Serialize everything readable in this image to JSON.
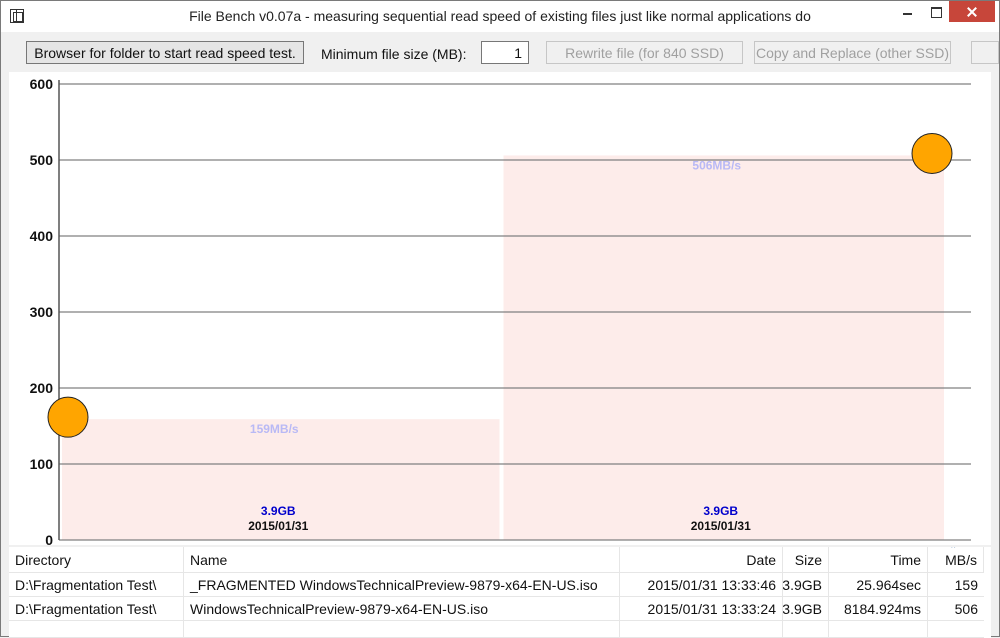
{
  "window": {
    "title": "File Bench v0.07a - measuring sequential read speed of existing files just like normal applications do"
  },
  "toolbar": {
    "browse_label": "Browser for folder to start read speed test.",
    "min_size_label": "Minimum file size (MB):",
    "min_size_value": "1",
    "rewrite_label": "Rewrite file (for 840 SSD)",
    "copy_replace_label": "Copy and Replace (other SSD)"
  },
  "chart_data": {
    "type": "bar",
    "categories": [
      "2015/01/31",
      "2015/01/31"
    ],
    "values": [
      159,
      506
    ],
    "size_labels": [
      "3.9GB",
      "3.9GB"
    ],
    "value_labels": [
      "159MB/s",
      "506MB/s"
    ],
    "title": "",
    "xlabel": "",
    "ylabel": "",
    "ylim": [
      0,
      600
    ],
    "yticks": [
      "0",
      "100",
      "200",
      "300",
      "400",
      "500",
      "600"
    ],
    "grid": true,
    "colors": {
      "bar": "#fdecea",
      "marker": "#ffa500",
      "value_label": "#b9b9f5",
      "size_label": "#0000cc",
      "grid": "#808080"
    }
  },
  "table": {
    "columns": [
      "Directory",
      "Name",
      "Date",
      "Size",
      "Time",
      "MB/s"
    ],
    "rows": [
      {
        "directory": "D:\\Fragmentation Test\\",
        "name": "_FRAGMENTED WindowsTechnicalPreview-9879-x64-EN-US.iso",
        "date": "2015/01/31 13:33:46",
        "size": "3.9GB",
        "time": "25.964sec",
        "mbs": "159"
      },
      {
        "directory": "D:\\Fragmentation Test\\",
        "name": "WindowsTechnicalPreview-9879-x64-EN-US.iso",
        "date": "2015/01/31 13:33:24",
        "size": "3.9GB",
        "time": "8184.924ms",
        "mbs": "506"
      }
    ]
  }
}
